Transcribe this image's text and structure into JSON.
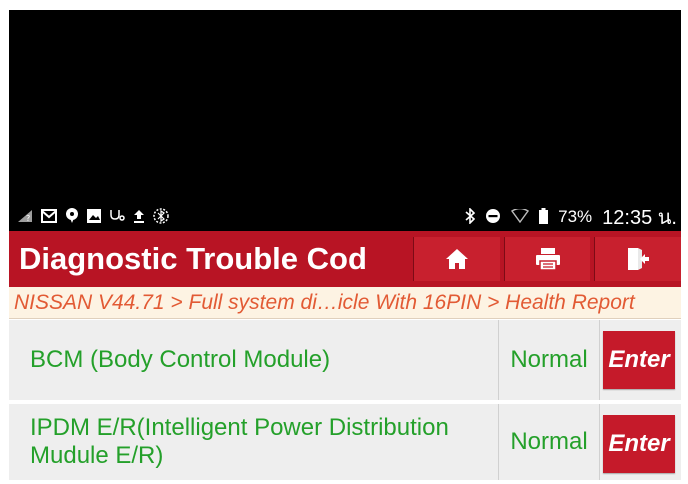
{
  "status_bar": {
    "left_icons": [
      "signal-icon",
      "gmail-icon",
      "chat-icon",
      "image-icon",
      "stethoscope-icon",
      "upload-icon",
      "bluetooth-off-icon"
    ],
    "right_icons": [
      "bluetooth-icon",
      "do-not-disturb-icon",
      "wifi-icon",
      "battery-icon"
    ],
    "battery": "73%",
    "time": "12:35 น."
  },
  "header": {
    "title": "Diagnostic Trouble Cod",
    "buttons": [
      "home-icon",
      "print-icon",
      "exit-icon"
    ]
  },
  "breadcrumb": "NISSAN V44.71 > Full system di…icle With 16PIN > Health Report",
  "modules": [
    {
      "name": "BCM (Body Control Module)",
      "status": "Normal",
      "action": "Enter"
    },
    {
      "name": "IPDM E/R(Intelligent Power Distribution Mudule E/R)",
      "status": "Normal",
      "action": "Enter"
    }
  ],
  "colors": {
    "header_bg": "#b81424",
    "breadcrumb_text": "#e25a34",
    "module_text": "#24a02a",
    "enter_button": "#c51a2a"
  }
}
